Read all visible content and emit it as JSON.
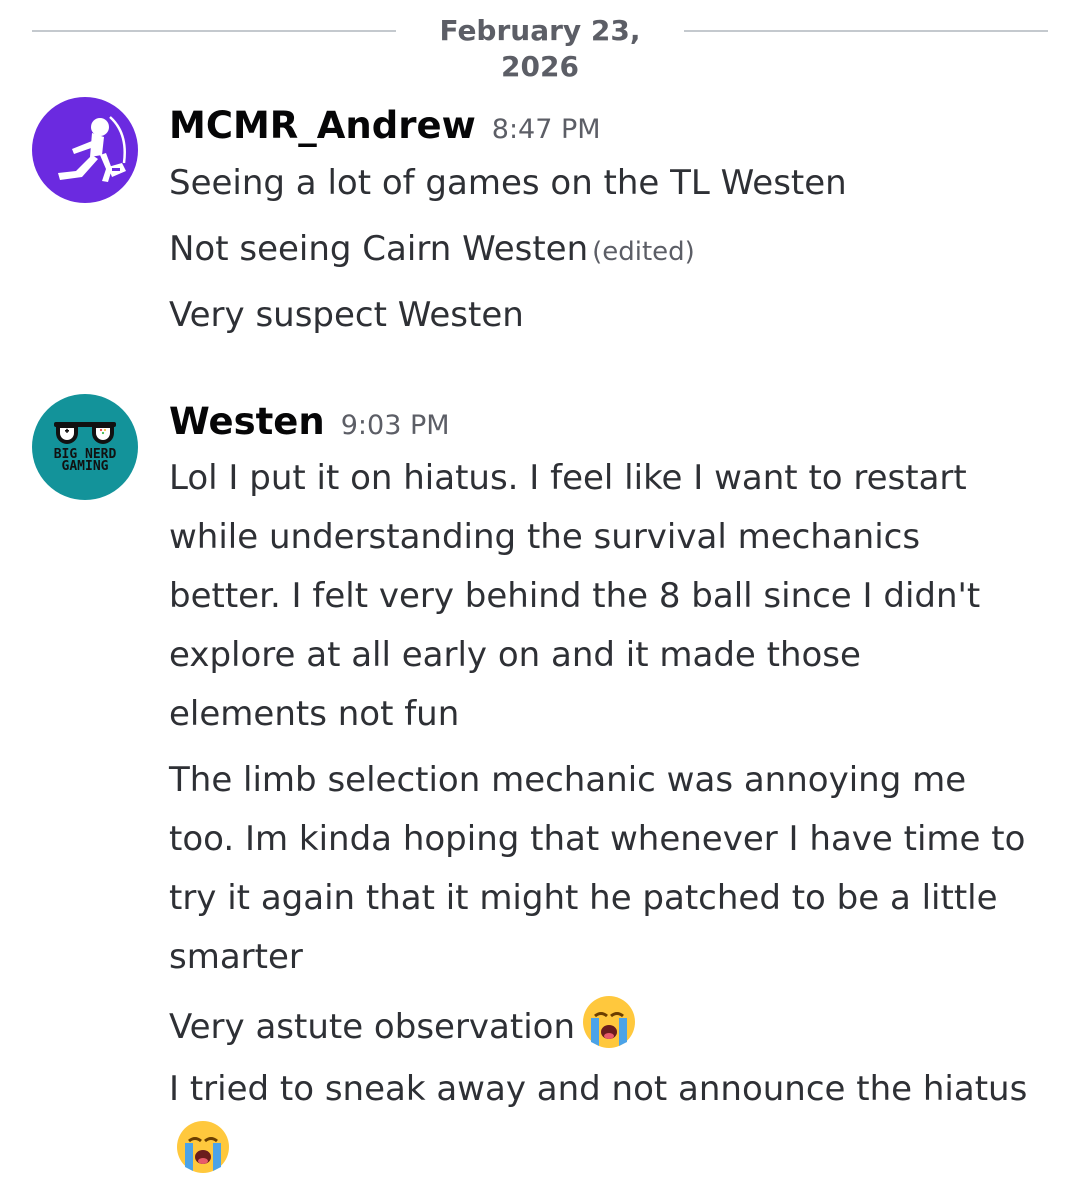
{
  "divider": {
    "date": "February 23, 2026"
  },
  "messages": [
    {
      "username": "MCMR_Andrew",
      "time": "8:47 PM",
      "avatar_icon": "astronaut-kicking-icon",
      "avatar_color": "#6b2ae0",
      "lines": [
        "Seeing a lot of games on the TL Westen",
        "Not seeing Cairn Westen",
        "Very suspect Westen"
      ],
      "edited_label": "(edited)"
    },
    {
      "username": "Westen",
      "time": "9:03 PM",
      "avatar_icon": "big-nerd-gaming-glasses-icon",
      "avatar_color": "#13939a",
      "avatar_text": "BIG NERD GAMING",
      "lines": [
        "Lol I put it on hiatus. I feel like I want to restart while understanding the survival mechanics better. I felt very behind the 8 ball since I didn't explore at all early on and it made those elements not fun",
        "The limb selection mechanic was annoying me too. Im kinda hoping that whenever I have time to try it again that it might he patched to be a little smarter",
        "Very astute observation",
        "I tried to sneak away and not announce the hiatus"
      ],
      "emoji": "loudly-crying-face-icon"
    }
  ]
}
